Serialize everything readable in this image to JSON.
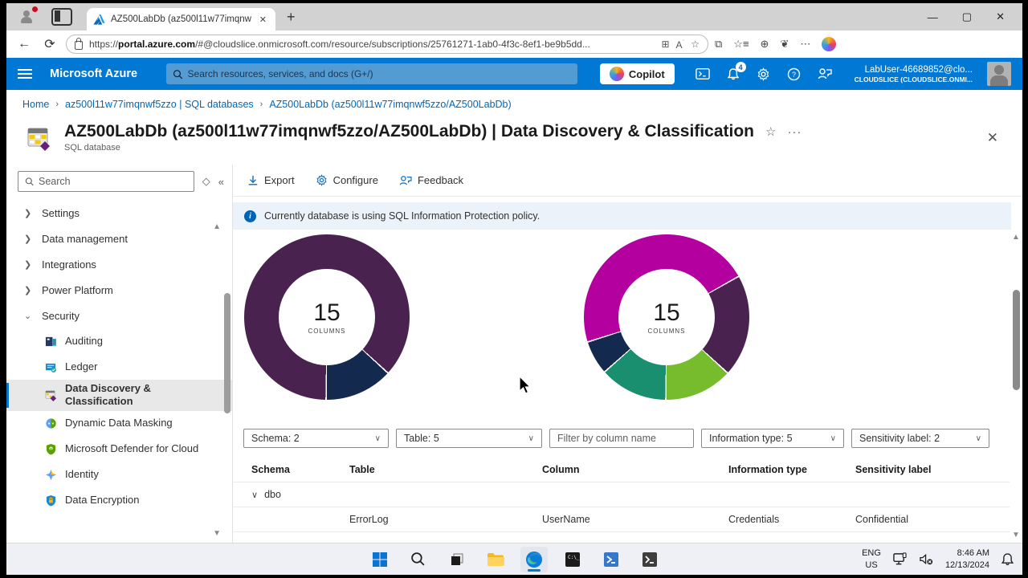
{
  "browser": {
    "tab_title": "AZ500LabDb (az500l11w77imqnw",
    "url_prefix": "https://",
    "url_domain": "portal.azure.com",
    "url_rest": "/#@cloudslice.onmicrosoft.com/resource/subscriptions/25761271-1ab0-4f3c-8ef1-be9b5dd..."
  },
  "azure_header": {
    "brand": "Microsoft Azure",
    "search_placeholder": "Search resources, services, and docs (G+/)",
    "copilot_label": "Copilot",
    "notification_count": "4",
    "account_user": "LabUser-46689852@clo...",
    "account_tenant": "CLOUDSLICE (CLOUDSLICE.ONMI..."
  },
  "breadcrumb": {
    "items": [
      {
        "label": "Home"
      },
      {
        "label": "az500l11w77imqnwf5zzo | SQL databases"
      },
      {
        "label": "AZ500LabDb (az500l11w77imqnwf5zzo/AZ500LabDb)"
      }
    ]
  },
  "page": {
    "title": "AZ500LabDb (az500l11w77imqnwf5zzo/AZ500LabDb) | Data Discovery & Classification",
    "subtitle": "SQL database"
  },
  "sidebar": {
    "search_placeholder": "Search",
    "groups": [
      {
        "label": "Settings"
      },
      {
        "label": "Data management"
      },
      {
        "label": "Integrations"
      },
      {
        "label": "Power Platform"
      },
      {
        "label": "Security"
      }
    ],
    "security_items": [
      {
        "label": "Auditing"
      },
      {
        "label": "Ledger"
      },
      {
        "label": "Data Discovery & Classification",
        "selected": true
      },
      {
        "label": "Dynamic Data Masking"
      },
      {
        "label": "Microsoft Defender for Cloud"
      },
      {
        "label": "Identity"
      },
      {
        "label": "Data Encryption"
      }
    ]
  },
  "toolbar": {
    "export_label": "Export",
    "configure_label": "Configure",
    "feedback_label": "Feedback"
  },
  "banner": {
    "text": "Currently database is using SQL Information Protection policy."
  },
  "chart_data": [
    {
      "type": "pie",
      "title": "Sensitivity label donut (2 labels)",
      "center_value": "15",
      "center_label": "COLUMNS",
      "total": 15,
      "rotation_deg": 180,
      "segments": [
        {
          "label": "dark-purple",
          "value": 13,
          "color": "#49224f"
        },
        {
          "label": "navy",
          "value": 2,
          "color": "#13294d"
        }
      ]
    },
    {
      "type": "pie",
      "title": "Information type donut (5 types)",
      "center_value": "15",
      "center_label": "COLUMNS",
      "total": 15,
      "rotation_deg": 252,
      "segments": [
        {
          "label": "magenta",
          "value": 7,
          "color": "#b4009e"
        },
        {
          "label": "dark-purple",
          "value": 3,
          "color": "#49224f"
        },
        {
          "label": "lime-green",
          "value": 2,
          "color": "#76bc2d"
        },
        {
          "label": "teal-green",
          "value": 2,
          "color": "#1a8f70"
        },
        {
          "label": "navy",
          "value": 1,
          "color": "#13294d"
        }
      ]
    }
  ],
  "filters": {
    "schema": "Schema: 2",
    "table": "Table: 5",
    "column_placeholder": "Filter by column name",
    "information_type": "Information type: 5",
    "sensitivity_label": "Sensitivity label: 2"
  },
  "table": {
    "headers": {
      "schema": "Schema",
      "table": "Table",
      "column": "Column",
      "information_type": "Information type",
      "sensitivity_label": "Sensitivity label"
    },
    "group_label": "dbo",
    "rows": [
      {
        "schema": "",
        "table": "ErrorLog",
        "column": "UserName",
        "information_type": "Credentials",
        "sensitivity_label": "Confidential"
      }
    ]
  },
  "taskbar": {
    "language": "ENG",
    "region": "US",
    "time": "8:46 AM",
    "date": "12/13/2024"
  }
}
